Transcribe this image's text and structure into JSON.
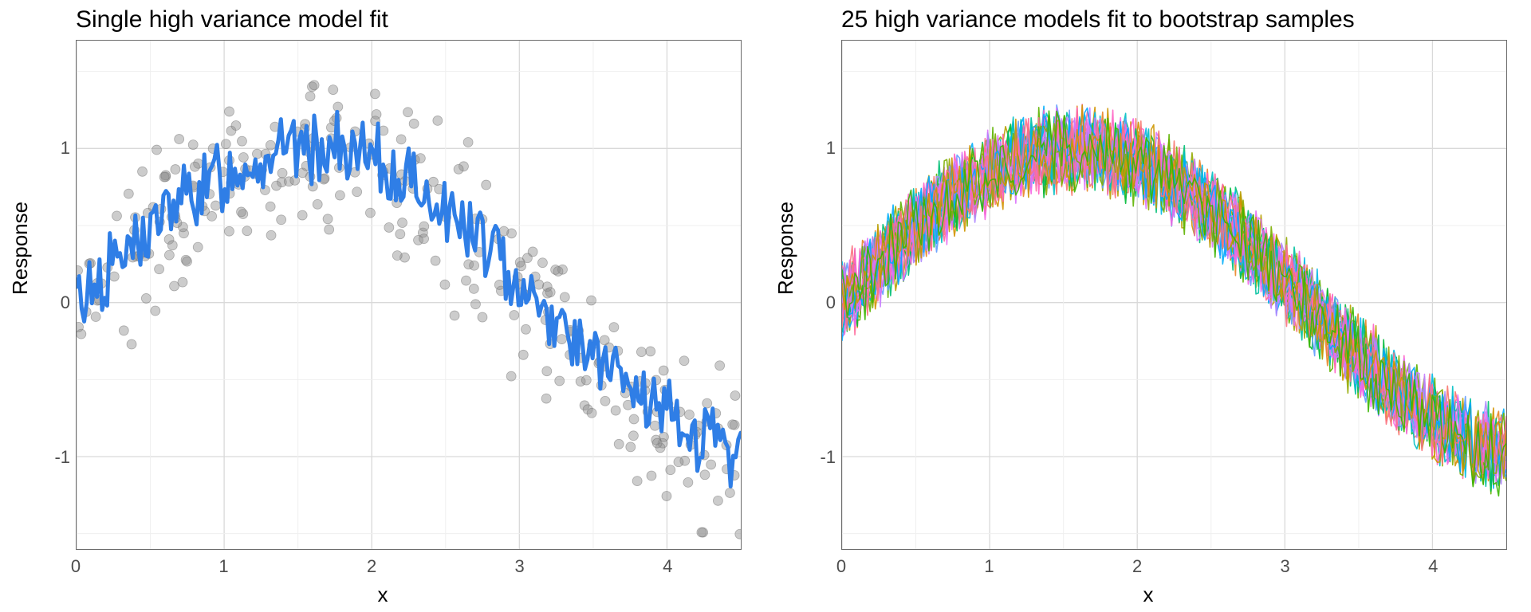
{
  "chart_data": [
    {
      "type": "scatter+line",
      "title": "Single high variance model fit",
      "xlabel": "x",
      "ylabel": "Response",
      "xlim": [
        0,
        4.5
      ],
      "ylim": [
        -1.6,
        1.7
      ],
      "xticks": [
        0,
        1,
        2,
        3,
        4
      ],
      "yticks": [
        -1,
        0,
        1
      ],
      "description": "Gray scatter of ~300 noisy points from sin(x) with sd≈0.25 plus a single blue jagged overfit curve tracking the cloud.",
      "series": [
        {
          "name": "data points",
          "type": "scatter",
          "color": "#8e8e8e",
          "n": 300,
          "generator": "y = sin(x) + N(0,0.25), x~U(0,4.5)"
        },
        {
          "name": "single model fit",
          "type": "line",
          "color": "#2f7ee6",
          "width": 4,
          "generator": "jagged overfit of sin(x)"
        }
      ]
    },
    {
      "type": "line",
      "title": "25 high variance models fit to bootstrap samples",
      "xlabel": "x",
      "ylabel": "Response",
      "xlim": [
        0,
        4.5
      ],
      "ylim": [
        -1.6,
        1.7
      ],
      "xticks": [
        0,
        1,
        2,
        3,
        4
      ],
      "yticks": [
        -1,
        0,
        1
      ],
      "description": "25 overlaid jagged line fits (bootstrap resamples) tracing a sin(x) arc, multicolored.",
      "series_count": 25,
      "palette": [
        "#F8766D",
        "#E88526",
        "#D39200",
        "#B79F00",
        "#93AA00",
        "#5EB300",
        "#00BA38",
        "#00BF74",
        "#00C19F",
        "#00BFC4",
        "#00B9E3",
        "#00ADFA",
        "#619CFF",
        "#AE87FF",
        "#DB72FB",
        "#F564E3",
        "#FF61C3",
        "#FF699C",
        "#E76BF3",
        "#C77CFF",
        "#7CAE00",
        "#00A9FF",
        "#FC717F",
        "#CD9600",
        "#39B600"
      ]
    }
  ]
}
